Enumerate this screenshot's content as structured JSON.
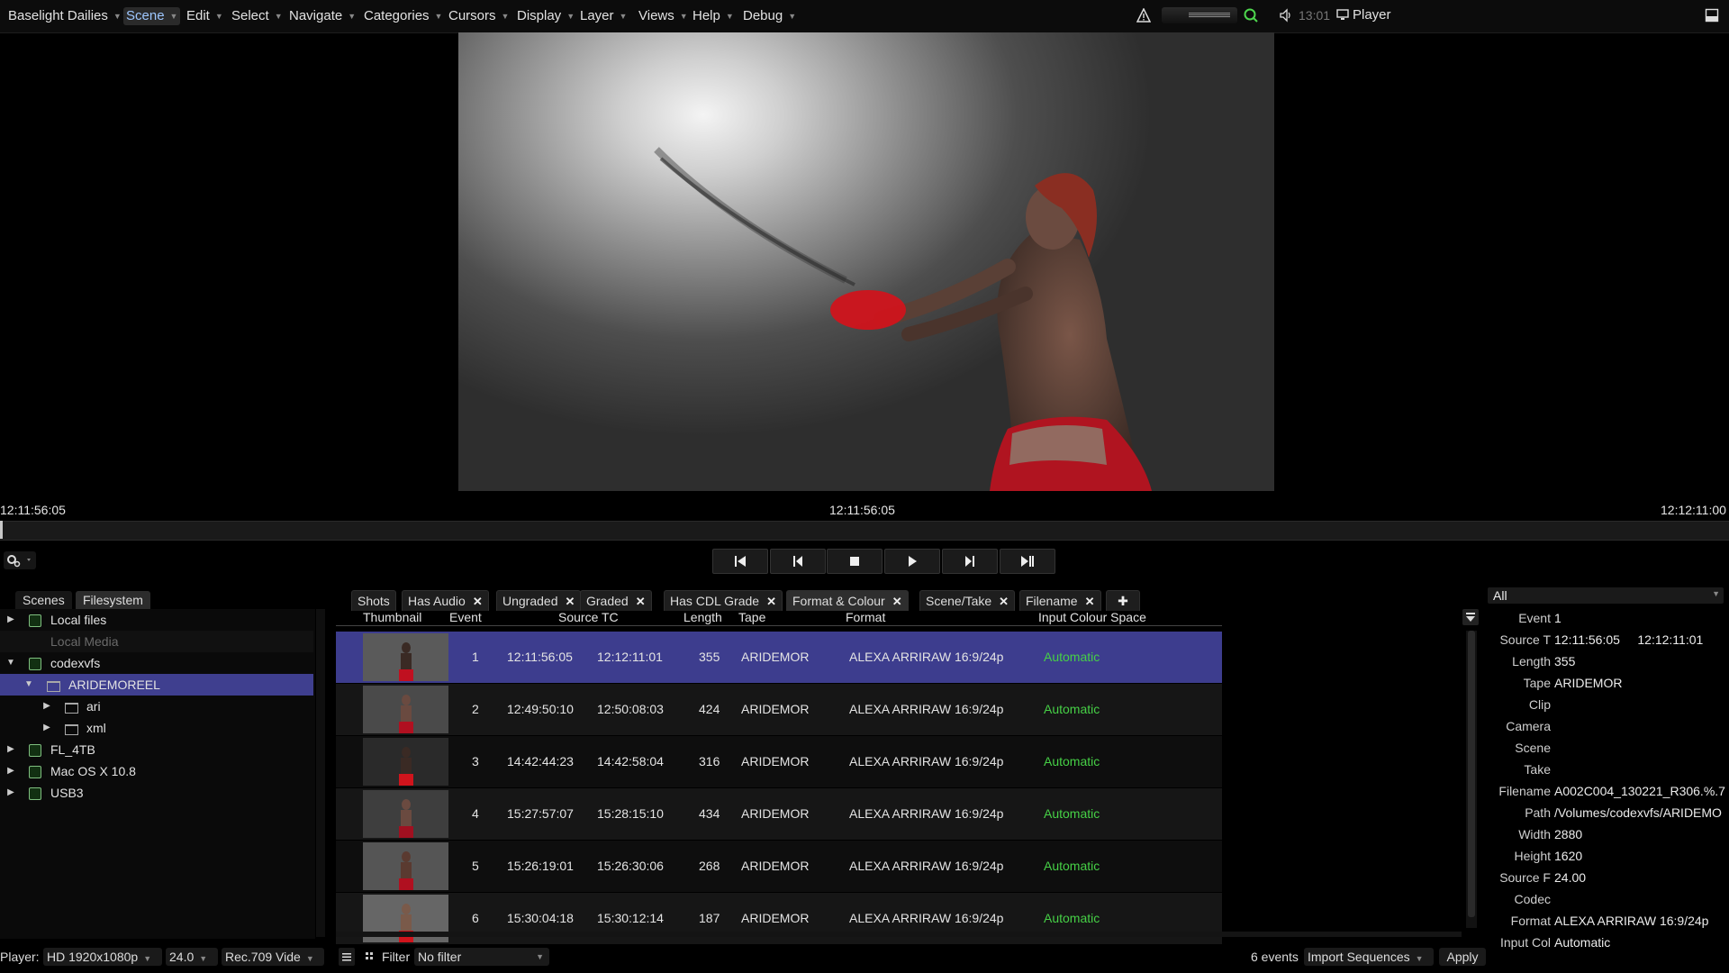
{
  "app": {
    "title": "Baselight Dailies",
    "player_label": "Player",
    "time": "13:01"
  },
  "menus": [
    {
      "label": "Scene"
    },
    {
      "label": "Edit"
    },
    {
      "label": "Select"
    },
    {
      "label": "Navigate"
    },
    {
      "label": "Categories"
    },
    {
      "label": "Cursors"
    },
    {
      "label": "Display"
    },
    {
      "label": "Layer"
    },
    {
      "label": "Views"
    },
    {
      "label": "Help"
    },
    {
      "label": "Debug"
    }
  ],
  "timeline": {
    "start_tc": "12:11:56:05",
    "current_tc": "12:11:56:05",
    "end_tc": "12:12:11:00",
    "playhead_fraction": 0.0
  },
  "transport": {
    "icons": [
      "skip-to-start-icon",
      "step-back-icon",
      "stop-icon",
      "play-icon",
      "step-forward-icon",
      "skip-to-end-icon"
    ]
  },
  "left_panel": {
    "tabs": [
      "Scenes",
      "Filesystem"
    ],
    "active_tab": "Filesystem",
    "tree": [
      {
        "label": "Local files",
        "depth": 0,
        "arrow": "right",
        "icon": "drive",
        "selected": false,
        "dim": false
      },
      {
        "label": "Local Media",
        "depth": 0,
        "arrow": "",
        "icon": "",
        "selected": false,
        "dim": true
      },
      {
        "label": "codexvfs",
        "depth": 0,
        "arrow": "down",
        "icon": "drive",
        "selected": false,
        "dim": false
      },
      {
        "label": "ARIDEMOREEL",
        "depth": 1,
        "arrow": "down",
        "icon": "folder",
        "selected": true,
        "dim": false
      },
      {
        "label": "ari",
        "depth": 2,
        "arrow": "right",
        "icon": "folder",
        "selected": false,
        "dim": false
      },
      {
        "label": "xml",
        "depth": 2,
        "arrow": "right",
        "icon": "folder",
        "selected": false,
        "dim": false
      },
      {
        "label": "FL_4TB",
        "depth": 0,
        "arrow": "right",
        "icon": "drive",
        "selected": false,
        "dim": false
      },
      {
        "label": "Mac OS X 10.8",
        "depth": 0,
        "arrow": "right",
        "icon": "drive",
        "selected": false,
        "dim": false
      },
      {
        "label": "USB3",
        "depth": 0,
        "arrow": "right",
        "icon": "drive",
        "selected": false,
        "dim": false
      }
    ]
  },
  "shot_tabs": [
    {
      "label": "Shots",
      "closable": false
    },
    {
      "label": "Has Audio",
      "closable": true
    },
    {
      "label": "Ungraded",
      "closable": true
    },
    {
      "label": "Graded",
      "closable": true
    },
    {
      "label": "Has CDL Grade",
      "closable": true
    },
    {
      "label": "Format & Colour",
      "closable": true
    },
    {
      "label": "Scene/Take",
      "closable": true
    },
    {
      "label": "Filename",
      "closable": true
    }
  ],
  "add_tab_symbol": "✚",
  "table": {
    "headers": [
      "Thumbnail",
      "Event",
      "Source TC",
      "Length",
      "Tape",
      "Format",
      "Input Colour Space"
    ],
    "rows": [
      {
        "event": "1",
        "tc_in": "12:11:56:05",
        "tc_out": "12:12:11:01",
        "length": "355",
        "tape": "ARIDEMOR",
        "format": "ALEXA ARRIRAW 16:9/24p",
        "colour": "Automatic",
        "selected": true
      },
      {
        "event": "2",
        "tc_in": "12:49:50:10",
        "tc_out": "12:50:08:03",
        "length": "424",
        "tape": "ARIDEMOR",
        "format": "ALEXA ARRIRAW 16:9/24p",
        "colour": "Automatic",
        "selected": false
      },
      {
        "event": "3",
        "tc_in": "14:42:44:23",
        "tc_out": "14:42:58:04",
        "length": "316",
        "tape": "ARIDEMOR",
        "format": "ALEXA ARRIRAW 16:9/24p",
        "colour": "Automatic",
        "selected": false
      },
      {
        "event": "4",
        "tc_in": "15:27:57:07",
        "tc_out": "15:28:15:10",
        "length": "434",
        "tape": "ARIDEMOR",
        "format": "ALEXA ARRIRAW 16:9/24p",
        "colour": "Automatic",
        "selected": false
      },
      {
        "event": "5",
        "tc_in": "15:26:19:01",
        "tc_out": "15:26:30:06",
        "length": "268",
        "tape": "ARIDEMOR",
        "format": "ALEXA ARRIRAW 16:9/24p",
        "colour": "Automatic",
        "selected": false
      },
      {
        "event": "6",
        "tc_in": "15:30:04:18",
        "tc_out": "15:30:12:14",
        "length": "187",
        "tape": "ARIDEMOR",
        "format": "ALEXA ARRIRAW 16:9/24p",
        "colour": "Automatic",
        "selected": false
      }
    ]
  },
  "inspector": {
    "dropdown": "All",
    "fields": [
      {
        "key": "Event",
        "value": "1"
      },
      {
        "key": "Source T",
        "value": "12:11:56:05     12:12:11:01"
      },
      {
        "key": "Length",
        "value": "355"
      },
      {
        "key": "Tape",
        "value": "ARIDEMOR"
      },
      {
        "key": "Clip",
        "value": ""
      },
      {
        "key": "Camera",
        "value": ""
      },
      {
        "key": "Scene",
        "value": ""
      },
      {
        "key": "Take",
        "value": ""
      },
      {
        "key": "Filename",
        "value": "A002C004_130221_R306.%.7"
      },
      {
        "key": "Path",
        "value": "/Volumes/codexvfs/ARIDEMO"
      },
      {
        "key": "Width",
        "value": "2880"
      },
      {
        "key": "Height",
        "value": "1620"
      },
      {
        "key": "Source F",
        "value": "24.00"
      },
      {
        "key": "Codec",
        "value": ""
      },
      {
        "key": "Format",
        "value": "ALEXA ARRIRAW 16:9/24p"
      },
      {
        "key": "Input Col",
        "value": "Automatic",
        "green": true
      }
    ]
  },
  "bottom_bar": {
    "player_label": "Player:",
    "resolution": "HD 1920x1080p",
    "fps": "24.0",
    "colour_space": "Rec.709 Vide",
    "filter_label": "Filter",
    "filter_value": "No filter",
    "event_count": "6 events",
    "import_label": "Import Sequences",
    "apply_label": "Apply"
  },
  "colors": {
    "selection": "#3d3d8e",
    "status_green": "#46d046",
    "accent_blue": "#9ec7ff"
  }
}
